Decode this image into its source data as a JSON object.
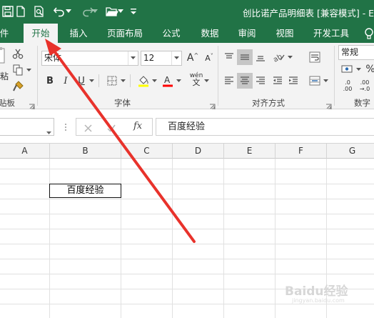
{
  "title_bar": {
    "window_title": "创比诺产品明细表 [兼容模式] - Exc"
  },
  "tabs": [
    {
      "label": "件"
    },
    {
      "label": "开始"
    },
    {
      "label": "插入"
    },
    {
      "label": "页面布局"
    },
    {
      "label": "公式"
    },
    {
      "label": "数据"
    },
    {
      "label": "审阅"
    },
    {
      "label": "视图"
    },
    {
      "label": "开发工具"
    }
  ],
  "ribbon": {
    "clipboard": {
      "paste_label": "粘",
      "group_label": "贴板"
    },
    "font": {
      "name": "宋体",
      "size": "12",
      "group_label": "字体",
      "bold": "B",
      "italic": "I",
      "underline": "U",
      "grow": "A",
      "shrink": "A",
      "phonetic_top": "wén",
      "phonetic_bottom": "文",
      "font_color": "#ff0000",
      "fill_color": "#ffff00"
    },
    "alignment": {
      "group_label": "对齐方式"
    },
    "number": {
      "format": "常规",
      "group_label": "数字",
      "percent": "%",
      "inc_dec_top": ".0",
      "inc_dec_mid": ".00",
      "dec_dec_top": ".00",
      "dec_dec_mid": "→.0"
    }
  },
  "formula_bar": {
    "fx": "fx",
    "value": "百度经验"
  },
  "grid": {
    "columns": [
      "A",
      "B",
      "C",
      "D",
      "E",
      "F",
      "G"
    ],
    "cells": {
      "B4": "百度经验"
    }
  },
  "watermark": {
    "text": "Baidu经验",
    "sub": "jingyan.baidu.com"
  },
  "colors": {
    "excel_green": "#217346",
    "annotation_arrow": "#e8322b"
  }
}
